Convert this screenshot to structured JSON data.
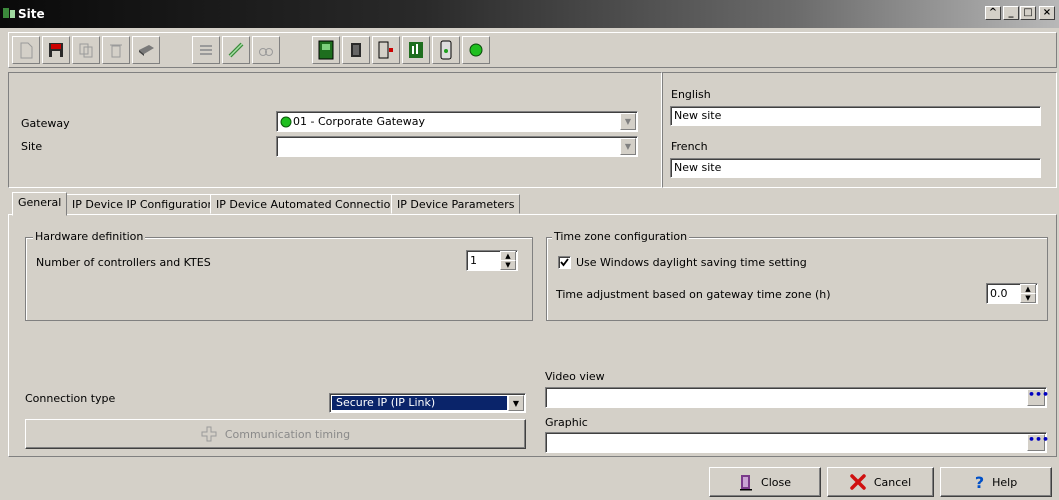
{
  "window": {
    "title": "Site"
  },
  "toolbar": {
    "icons": [
      "new-icon",
      "save-icon",
      "copy-icon",
      "delete-icon",
      "print-icon",
      "list-icon",
      "link-icon",
      "find-icon",
      "controller-icon",
      "door-icon",
      "door-exit-icon",
      "io-module-icon",
      "reader-icon",
      "status-green-icon"
    ]
  },
  "header": {
    "gateway_label": "Gateway",
    "gateway_value": "01 - Corporate Gateway",
    "site_label": "Site",
    "site_value": "",
    "english_label": "English",
    "english_value": "New site",
    "french_label": "French",
    "french_value": "New site"
  },
  "tabs": [
    {
      "label": "General",
      "active": true
    },
    {
      "label": "IP Device IP Configuration",
      "active": false
    },
    {
      "label": "IP Device Automated Connection",
      "active": false
    },
    {
      "label": "IP Device Parameters",
      "active": false
    }
  ],
  "general": {
    "hardware_title": "Hardware definition",
    "controllers_label": "Number of controllers and KTES",
    "controllers_value": "1",
    "timezone_title": "Time zone configuration",
    "dst_label": "Use Windows daylight saving time setting",
    "dst_checked": true,
    "tz_adjust_label": "Time adjustment based on gateway time zone (h)",
    "tz_adjust_value": "0.0",
    "connection_type_label": "Connection type",
    "connection_type_value": "Secure IP (IP Link)",
    "comm_timing_label": "Communication timing",
    "video_view_label": "Video view",
    "video_view_value": "",
    "graphic_label": "Graphic",
    "graphic_value": ""
  },
  "footer": {
    "close_label": "Close",
    "cancel_label": "Cancel",
    "help_label": "Help"
  }
}
